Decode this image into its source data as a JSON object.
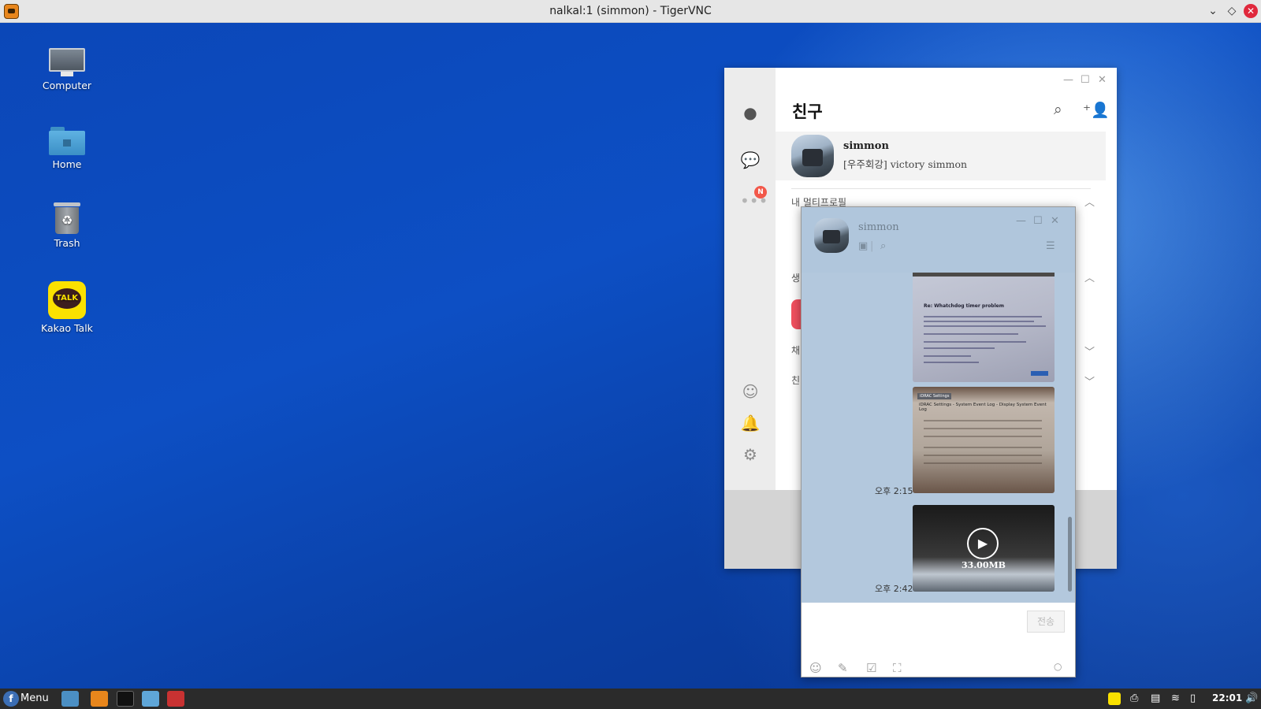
{
  "vnc": {
    "title": "nalkal:1 (simmon) - TigerVNC"
  },
  "desktop": {
    "icons": [
      {
        "label": "Computer",
        "icon": "computer-icon"
      },
      {
        "label": "Home",
        "icon": "home-folder-icon"
      },
      {
        "label": "Trash",
        "icon": "trash-icon"
      },
      {
        "label": "Kakao Talk",
        "icon": "kakaotalk-icon",
        "badge": "TALK"
      }
    ]
  },
  "kakao": {
    "title": "친구",
    "badge": "N",
    "profile": {
      "name": "simmon",
      "status": "[우주회강] victory simmon"
    },
    "sections": [
      "내 멀티프로필",
      "생",
      "채",
      "친"
    ]
  },
  "chat": {
    "name": "simmon",
    "doc1_title": "Re: Whatchdog timer problem",
    "doc2_header": "iDRAC Settings",
    "doc2_title": "iDRAC Settings - System Event Log - Display System Event Log",
    "time1": "오후 2:15",
    "time2": "오후 2:42",
    "video_size": "33.00MB",
    "send_label": "전송"
  },
  "taskbar": {
    "menu_label": "Menu",
    "clock": "22:01"
  },
  "colors": {
    "kakao_yellow": "#fae100",
    "chat_bg": "#b3c8dd",
    "badge_red": "#f2584a",
    "taskbar": "#2b2b2b"
  }
}
